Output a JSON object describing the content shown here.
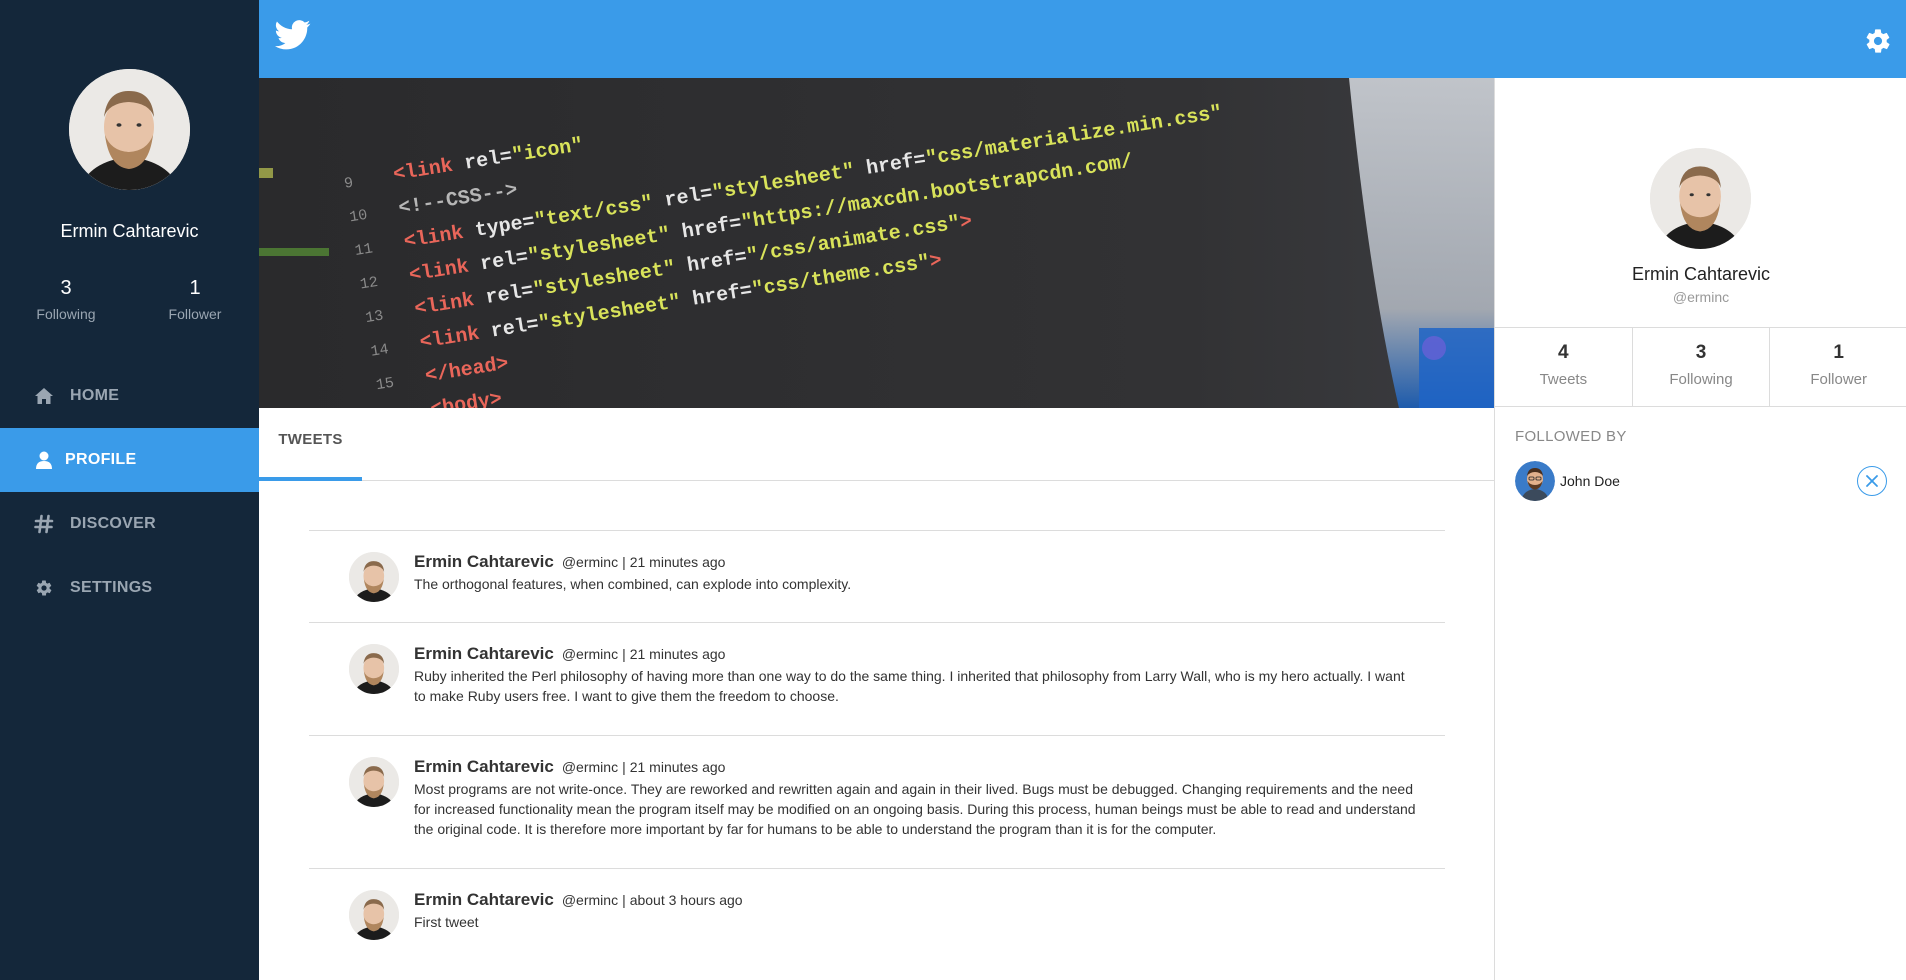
{
  "sidebar": {
    "avatar_icon": "user-avatar-bearded-man",
    "name": "Ermin Cahtarevic",
    "following_count": "3",
    "following_label": "Following",
    "follower_count": "1",
    "follower_label": "Follower",
    "nav": [
      {
        "label": "HOME",
        "icon": "home-icon",
        "active": false
      },
      {
        "label": "PROFILE",
        "icon": "user-icon",
        "active": true
      },
      {
        "label": "DISCOVER",
        "icon": "hashtag-icon",
        "active": false
      },
      {
        "label": "SETTINGS",
        "icon": "gear-icon",
        "active": false
      }
    ]
  },
  "topbar": {
    "logo_icon": "twitter-bird-icon",
    "settings_icon": "gear-icon",
    "color": "#3a9be9"
  },
  "banner": {
    "description_icon": "code-screen-banner"
  },
  "tabs": [
    {
      "label": "TWEETS",
      "active": true
    }
  ],
  "tweets": [
    {
      "author": "Ermin Cahtarevic",
      "handle": "@erminc",
      "separator": "|",
      "time": "21 minutes ago",
      "text": "The orthogonal features, when combined, can explode into complexity."
    },
    {
      "author": "Ermin Cahtarevic",
      "handle": "@erminc",
      "separator": "|",
      "time": "21 minutes ago",
      "text": "Ruby inherited the Perl philosophy of having more than one way to do the same thing. I inherited that philosophy from Larry Wall, who is my hero actually. I want to make Ruby users free. I want to give them the freedom to choose."
    },
    {
      "author": "Ermin Cahtarevic",
      "handle": "@erminc",
      "separator": "|",
      "time": "21 minutes ago",
      "text": "Most programs are not write-once. They are reworked and rewritten again and again in their lived. Bugs must be debugged. Changing requirements and the need for increased functionality mean the program itself may be modified on an ongoing basis. During this process, human beings must be able to read and understand the original code. It is therefore more important by far for humans to be able to understand the program than it is for the computer."
    },
    {
      "author": "Ermin Cahtarevic",
      "handle": "@erminc",
      "separator": "|",
      "time": "about 3 hours ago",
      "text": "First tweet"
    }
  ],
  "profile_card": {
    "name": "Ermin Cahtarevic",
    "handle": "@erminc",
    "stats": [
      {
        "count": "4",
        "label": "Tweets"
      },
      {
        "count": "3",
        "label": "Following"
      },
      {
        "count": "1",
        "label": "Follower"
      }
    ],
    "followed_by_title": "FOLLOWED BY",
    "followers": [
      {
        "name": "John Doe",
        "icon": "john-doe-avatar",
        "action_icon": "close-circle-icon"
      }
    ]
  },
  "colors": {
    "sidebar_bg": "#14273a",
    "accent": "#3a9be9",
    "muted_text": "#9aa6b2"
  }
}
